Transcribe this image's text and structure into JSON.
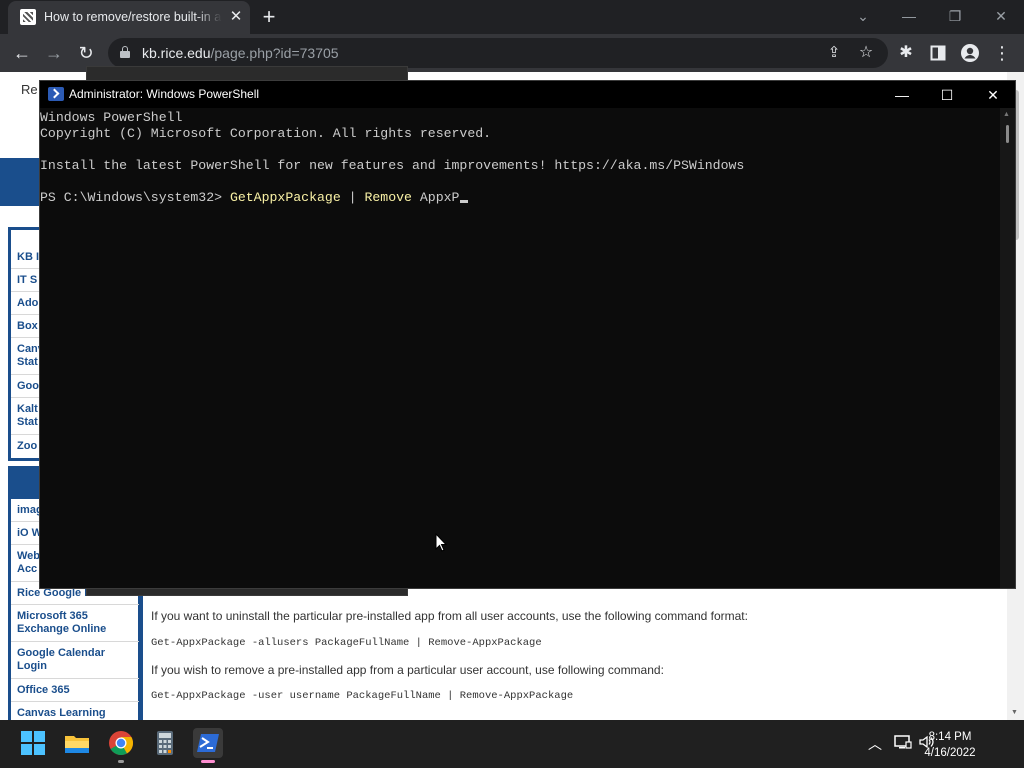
{
  "browser": {
    "tab_title": "How to remove/restore built-in apps",
    "url_host": "kb.rice.edu",
    "url_path": "/page.php?id=73705",
    "window_controls": {
      "tabsearch": "⌄",
      "minimize": "—",
      "restore": "❐",
      "close": "✕"
    }
  },
  "webpage": {
    "top_text": "Re",
    "sidebar_top": [
      {
        "label": "KB I"
      },
      {
        "label": "IT S"
      },
      {
        "label": "Ado"
      },
      {
        "label": "Box"
      },
      {
        "label": "Canv\nStat"
      },
      {
        "label": "Goo"
      },
      {
        "label": "Kalt\nStat"
      },
      {
        "label": "Zoo"
      }
    ],
    "sidebar_bottom": [
      {
        "label": "imag"
      },
      {
        "label": "iO W"
      },
      {
        "label": "Web\nAcc"
      },
      {
        "label": "Rice Google I"
      },
      {
        "label": "Microsoft 365\nExchange Online"
      },
      {
        "label": "Google Calendar\nLogin"
      },
      {
        "label": "Office 365"
      },
      {
        "label": "Canvas Learning"
      }
    ],
    "para1": "If you want to uninstall the particular pre-installed app from all user accounts, use the following command format:",
    "code1": "Get-AppxPackage -allusers PackageFullName | Remove-AppxPackage",
    "para2": "If you wish to remove a pre-installed app from a particular user account, use following command:",
    "code2": "Get-AppxPackage -user username PackageFullName | Remove-AppxPackage"
  },
  "powershell": {
    "title": "Administrator: Windows PowerShell",
    "controls": {
      "minimize": "—",
      "maximize": "☐",
      "close": "✕"
    },
    "line1": "Windows PowerShell",
    "line2": "Copyright (C) Microsoft Corporation. All rights reserved.",
    "line3": "Install the latest PowerShell for new features and improvements! https://aka.ms/PSWindows",
    "prompt": "PS C:\\Windows\\system32> ",
    "command": "GetAppxPackage",
    "pipe": " | ",
    "command2": "Remove",
    "arg": " AppxP"
  },
  "taskbar": {
    "apps": [
      "start-icon",
      "file-explorer-icon",
      "chrome-icon",
      "calculator-icon",
      "powershell-icon"
    ],
    "time": "8:14 PM",
    "date": "4/16/2022"
  }
}
